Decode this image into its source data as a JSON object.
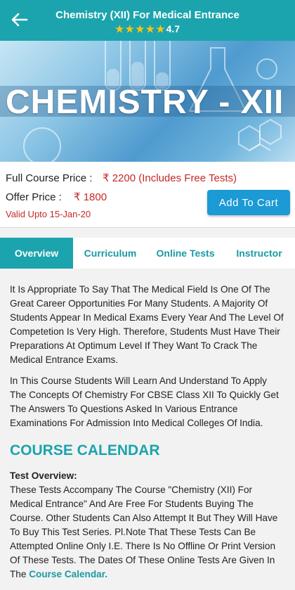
{
  "header": {
    "title": "Chemistry (XII) For Medical Entrance",
    "stars": "★★★★★",
    "rating": "4.7"
  },
  "banner": {
    "title": "CHEMISTRY - XII"
  },
  "pricing": {
    "full_label": "Full Course Price :",
    "full_value": "₹ 2200 (Includes Free Tests)",
    "offer_label": "Offer Price :",
    "offer_value": "₹ 1800",
    "valid": "Valid Upto 15-Jan-20",
    "cart_button": "Add To Cart"
  },
  "tabs": [
    {
      "label": "Overview",
      "active": true
    },
    {
      "label": "Curriculum",
      "active": false
    },
    {
      "label": "Online Tests",
      "active": false
    },
    {
      "label": "Instructor",
      "active": false
    }
  ],
  "overview": {
    "para1": "It Is Appropriate To Say That The Medical Field Is One Of The Great Career Opportunities For Many Students. A Majority Of Students Appear In Medical Exams Every Year And The Level Of Competetion Is Very High. Therefore, Students Must Have Their Preparations At Optimum Level If They Want To Crack The Medical Entrance Exams.",
    "para2": "In This Course Students Will Learn And Understand To Apply The Concepts Of Chemistry For CBSE Class XII To Quickly Get The Answers To Questions Asked In Various Entrance Examinations For Admission Into Medical Colleges Of India.",
    "calendar_title": "COURSE CALENDAR",
    "test_overview_label": "Test Overview:",
    "test_text": "These Tests Accompany The Course \"Chemistry (XII) For Medical Entrance\" And Are Free For Students Buying The Course. Other Students Can Also Attempt It But They Will Have To Buy This Test Series. Pl.Note That These Tests Can Be Attempted Online Only I.E. There Is No Offline Or Print Version Of These Tests. The Dates Of These Online Tests Are Given In The ",
    "calendar_link": "Course Calendar."
  },
  "colors": {
    "accent": "#1ba4ad",
    "button": "#1b9ad6",
    "price_red": "#c62828"
  }
}
